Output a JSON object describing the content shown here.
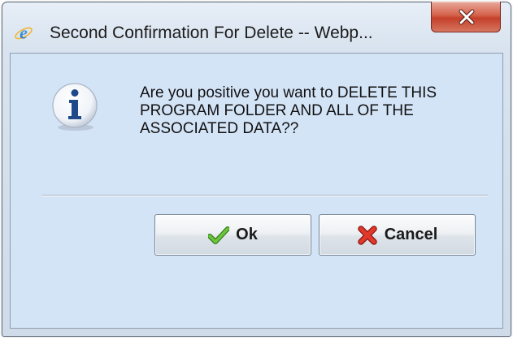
{
  "window": {
    "title": "Second Confirmation For Delete -- Webp..."
  },
  "dialog": {
    "message": "Are you positive you want to DELETE THIS PROGRAM FOLDER AND ALL OF THE ASSOCIATED DATA??",
    "icon": "information-icon"
  },
  "buttons": {
    "ok_label": "Ok",
    "cancel_label": "Cancel"
  },
  "icons": {
    "title": "ie-icon",
    "close": "close-icon",
    "ok": "checkmark-icon",
    "cancel": "cross-icon"
  },
  "colors": {
    "client_background": "#d4e4f7",
    "close_button": "#c4402a",
    "ok_icon": "#4aa229",
    "cancel_icon": "#d2281d",
    "info_icon": "#1f4a8a"
  }
}
